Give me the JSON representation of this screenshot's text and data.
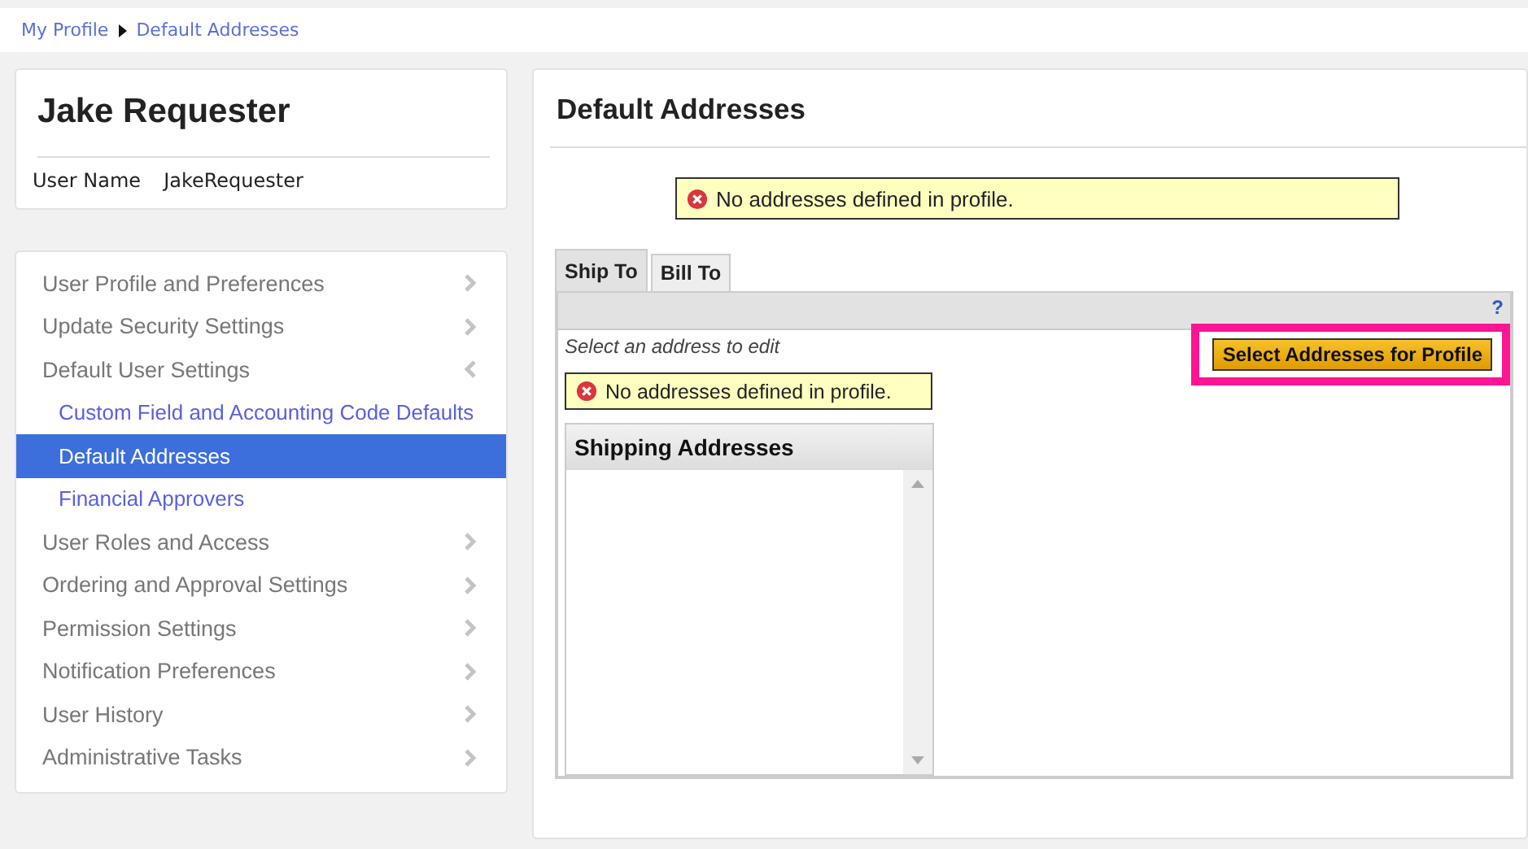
{
  "breadcrumb": [
    "My Profile",
    "Default Addresses"
  ],
  "profile": {
    "name": "Jake Requester",
    "field_label": "User Name",
    "field_value": "JakeRequester"
  },
  "sidebar": {
    "items": [
      {
        "kind": "section",
        "label": "User Profile and Preferences",
        "expanded": false
      },
      {
        "kind": "section",
        "label": "Update Security Settings",
        "expanded": false
      },
      {
        "kind": "section",
        "label": "Default User Settings",
        "expanded": true
      },
      {
        "kind": "subitem",
        "label": "Custom Field and Accounting Code Defaults",
        "selected": false
      },
      {
        "kind": "subitem",
        "label": "Default Addresses",
        "selected": true
      },
      {
        "kind": "subitem",
        "label": "Financial Approvers",
        "selected": false
      },
      {
        "kind": "section",
        "label": "User Roles and Access",
        "expanded": false
      },
      {
        "kind": "section",
        "label": "Ordering and Approval Settings",
        "expanded": false
      },
      {
        "kind": "section",
        "label": "Permission Settings",
        "expanded": false
      },
      {
        "kind": "section",
        "label": "Notification Preferences",
        "expanded": false
      },
      {
        "kind": "section",
        "label": "User History",
        "expanded": false
      },
      {
        "kind": "section",
        "label": "Administrative Tasks",
        "expanded": false
      }
    ]
  },
  "main": {
    "title": "Default Addresses",
    "notice": "No addresses defined in profile.",
    "tabs": [
      {
        "label": "Ship To",
        "selected": true
      },
      {
        "label": "Bill To",
        "selected": false
      }
    ],
    "help": "?",
    "hint": "Select an address to edit",
    "button": "Select Addresses for Profile",
    "button_highlighted": true,
    "inner_notice": "No addresses defined in profile.",
    "list_title": "Shipping Addresses"
  }
}
